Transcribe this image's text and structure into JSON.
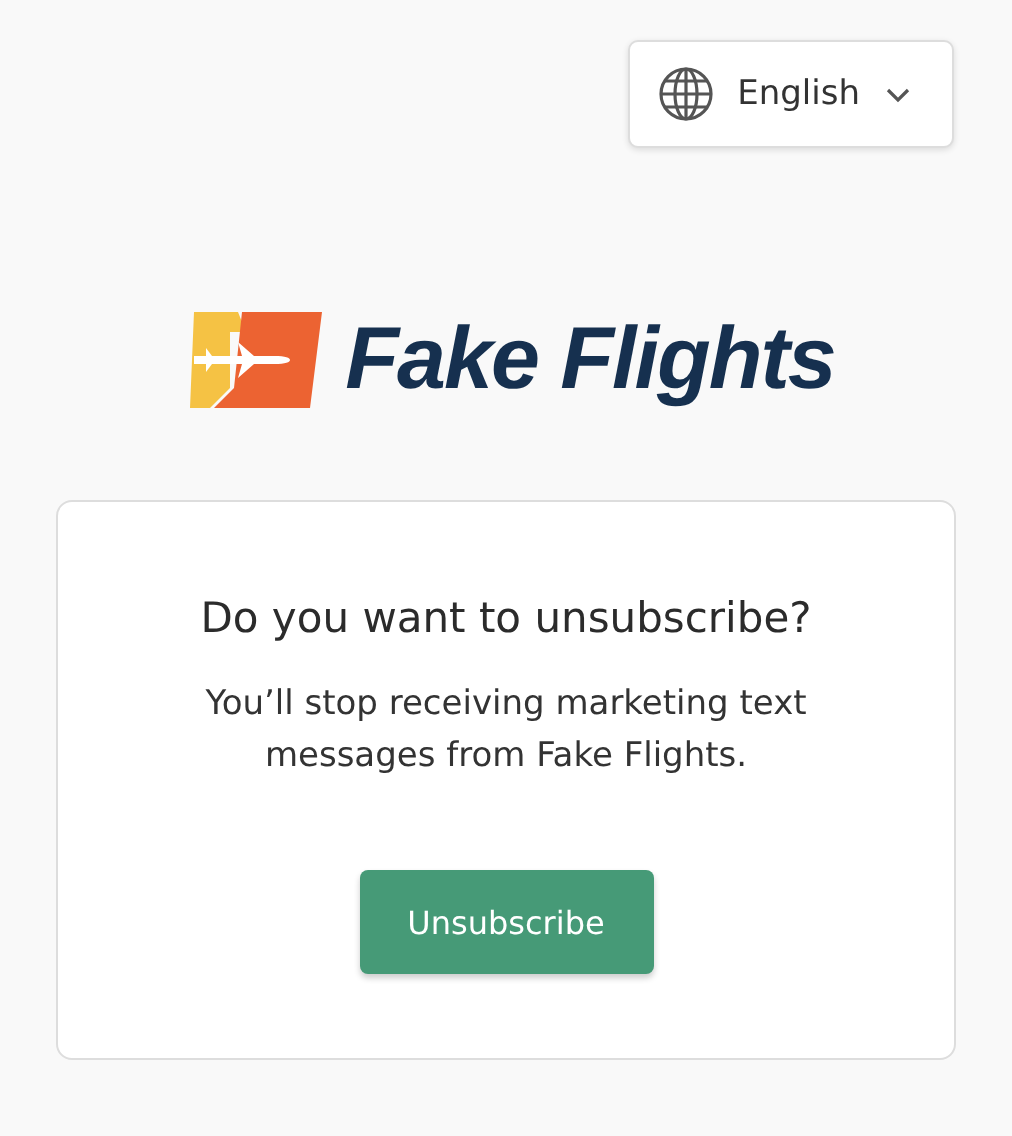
{
  "language_selector": {
    "label": "English"
  },
  "brand": {
    "name": "Fake Flights"
  },
  "card": {
    "title": "Do you want to unsubscribe?",
    "message": "You’ll stop receiving marketing text messages from Fake Flights.",
    "button": "Unsubscribe"
  }
}
